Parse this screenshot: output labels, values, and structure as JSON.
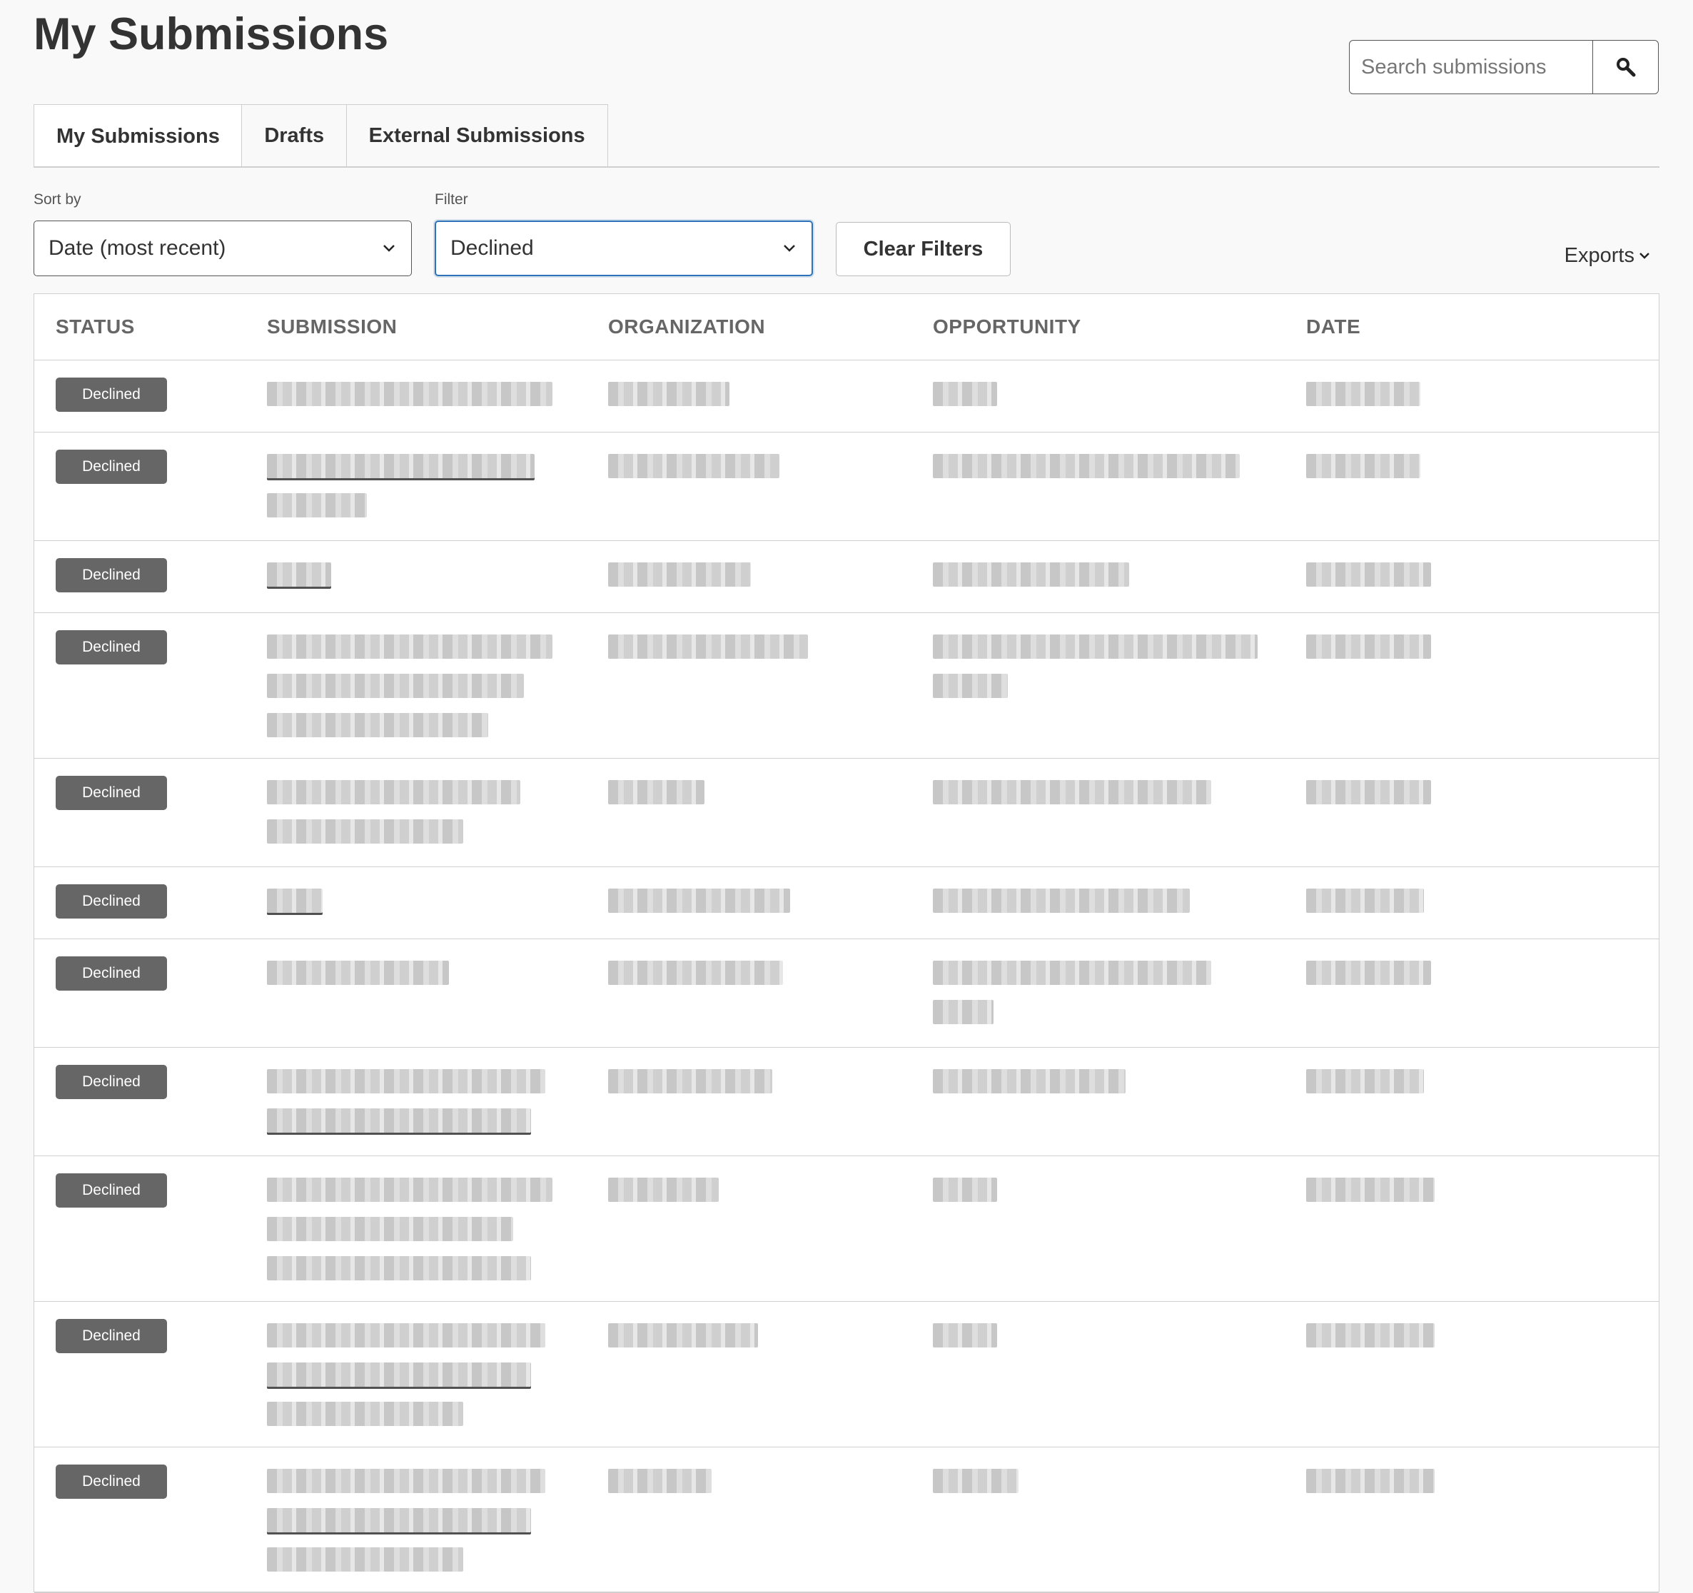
{
  "page": {
    "title": "My Submissions"
  },
  "search": {
    "placeholder": "Search submissions"
  },
  "tabs": [
    {
      "label": "My Submissions",
      "active": true
    },
    {
      "label": "Drafts",
      "active": false
    },
    {
      "label": "External Submissions",
      "active": false
    }
  ],
  "controls": {
    "sort_label": "Sort by",
    "sort_value": "Date (most recent)",
    "filter_label": "Filter",
    "filter_value": "Declined",
    "clear_label": "Clear Filters",
    "exports_label": "Exports"
  },
  "table": {
    "columns": [
      "STATUS",
      "SUBMISSION",
      "ORGANIZATION",
      "OPPORTUNITY",
      "DATE"
    ],
    "rows": [
      {
        "status": "Declined",
        "sub_lines": [
          400
        ],
        "sub_link_lines": [],
        "org_lines": [
          170
        ],
        "opp_lines": [
          90
        ],
        "date_lines": [
          160
        ]
      },
      {
        "status": "Declined",
        "sub_lines": [
          375,
          140
        ],
        "sub_link_lines": [
          0
        ],
        "org_lines": [
          240
        ],
        "opp_lines": [
          430
        ],
        "date_lines": [
          160
        ]
      },
      {
        "status": "Declined",
        "sub_lines": [
          90
        ],
        "sub_link_lines": [
          0
        ],
        "org_lines": [
          200
        ],
        "opp_lines": [
          275
        ],
        "date_lines": [
          175
        ]
      },
      {
        "status": "Declined",
        "sub_lines": [
          400,
          360,
          310
        ],
        "sub_link_lines": [],
        "org_lines": [
          280
        ],
        "opp_lines": [
          455,
          105
        ],
        "date_lines": [
          175
        ]
      },
      {
        "status": "Declined",
        "sub_lines": [
          355,
          275
        ],
        "sub_link_lines": [],
        "org_lines": [
          135
        ],
        "opp_lines": [
          390
        ],
        "date_lines": [
          175
        ]
      },
      {
        "status": "Declined",
        "sub_lines": [
          78
        ],
        "sub_link_lines": [
          0
        ],
        "org_lines": [
          255
        ],
        "opp_lines": [
          360
        ],
        "date_lines": [
          165
        ]
      },
      {
        "status": "Declined",
        "sub_lines": [
          255
        ],
        "sub_link_lines": [],
        "org_lines": [
          245
        ],
        "opp_lines": [
          390,
          85
        ],
        "date_lines": [
          175
        ]
      },
      {
        "status": "Declined",
        "sub_lines": [
          390,
          370
        ],
        "sub_link_lines": [
          1
        ],
        "org_lines": [
          230
        ],
        "opp_lines": [
          270
        ],
        "date_lines": [
          165
        ]
      },
      {
        "status": "Declined",
        "sub_lines": [
          400,
          345,
          370
        ],
        "sub_link_lines": [],
        "org_lines": [
          155
        ],
        "opp_lines": [
          90
        ],
        "date_lines": [
          180
        ]
      },
      {
        "status": "Declined",
        "sub_lines": [
          390,
          370,
          275
        ],
        "sub_link_lines": [
          1
        ],
        "org_lines": [
          210
        ],
        "opp_lines": [
          90
        ],
        "date_lines": [
          180
        ]
      },
      {
        "status": "Declined",
        "sub_lines": [
          390,
          370,
          275
        ],
        "sub_link_lines": [
          1
        ],
        "org_lines": [
          145
        ],
        "opp_lines": [
          120
        ],
        "date_lines": [
          180
        ]
      }
    ]
  }
}
